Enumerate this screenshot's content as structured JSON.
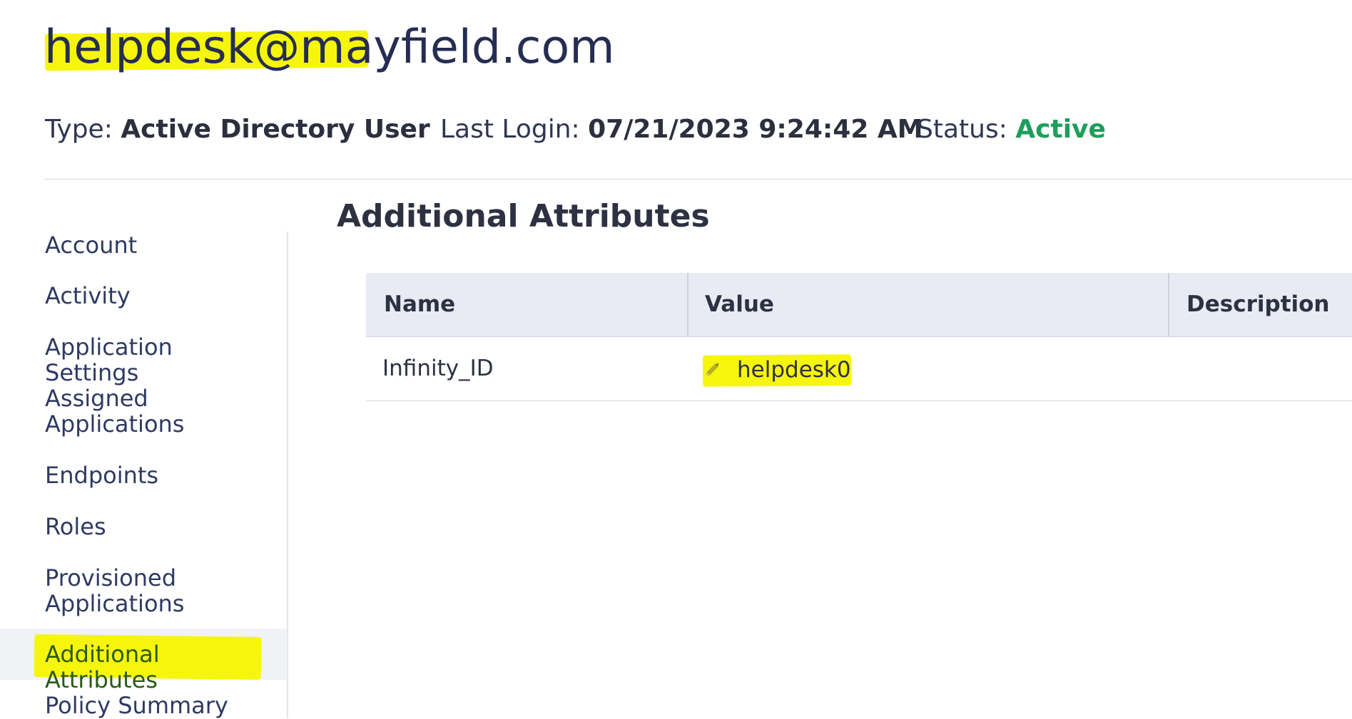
{
  "header": {
    "title": "helpdesk@mayfield.com",
    "type_label": "Type:",
    "type_value": "Active Directory User",
    "last_login_label": "Last Login:",
    "last_login_value": "07/21/2023 9:24:42 AM",
    "status_label": "Status:",
    "status_value": "Active"
  },
  "sidebar": {
    "items": [
      {
        "label": "Account"
      },
      {
        "label": "Activity"
      },
      {
        "label": "Application Settings"
      },
      {
        "label": "Assigned Applications"
      },
      {
        "label": "Endpoints"
      },
      {
        "label": "Roles"
      },
      {
        "label": "Provisioned Applications"
      },
      {
        "label": "Additional Attributes",
        "active": true
      },
      {
        "label": "Policy Summary"
      }
    ]
  },
  "main": {
    "section_title": "Additional Attributes",
    "table": {
      "columns": [
        "Name",
        "Value",
        "Description"
      ],
      "rows": [
        {
          "name": "Infinity_ID",
          "value": "helpdesk0",
          "description": ""
        }
      ]
    }
  },
  "colors": {
    "highlight": "#f6f600",
    "status_active": "#1e9e5a",
    "title_text": "#262d52",
    "table_header_bg": "#e9ebf4"
  },
  "icons": {
    "row_value_edit": "pencil-icon"
  }
}
